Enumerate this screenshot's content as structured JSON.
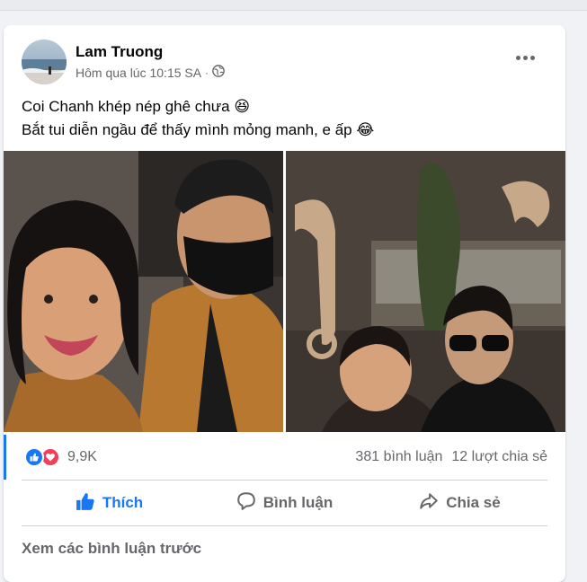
{
  "post": {
    "author": "Lam Truong",
    "timestamp": "Hôm qua lúc 10:15 SA",
    "privacy_icon": "globe-icon",
    "text_line1": "Coi Chanh khép nép ghê chưa 😆",
    "text_line2": "Bắt tui diễn ngầu để thấy mình mỏng manh, e ấp 😂",
    "more_icon": "more-options-icon"
  },
  "stats": {
    "reaction_count": "9,9K",
    "comments": "381 bình luận",
    "shares": "12 lượt chia sẻ"
  },
  "actions": {
    "like": "Thích",
    "comment": "Bình luận",
    "share": "Chia sẻ"
  },
  "comments": {
    "view_previous": "Xem các bình luận trước"
  },
  "colors": {
    "accent": "#1877f2",
    "love": "#f33e58",
    "muted": "#65676b"
  }
}
